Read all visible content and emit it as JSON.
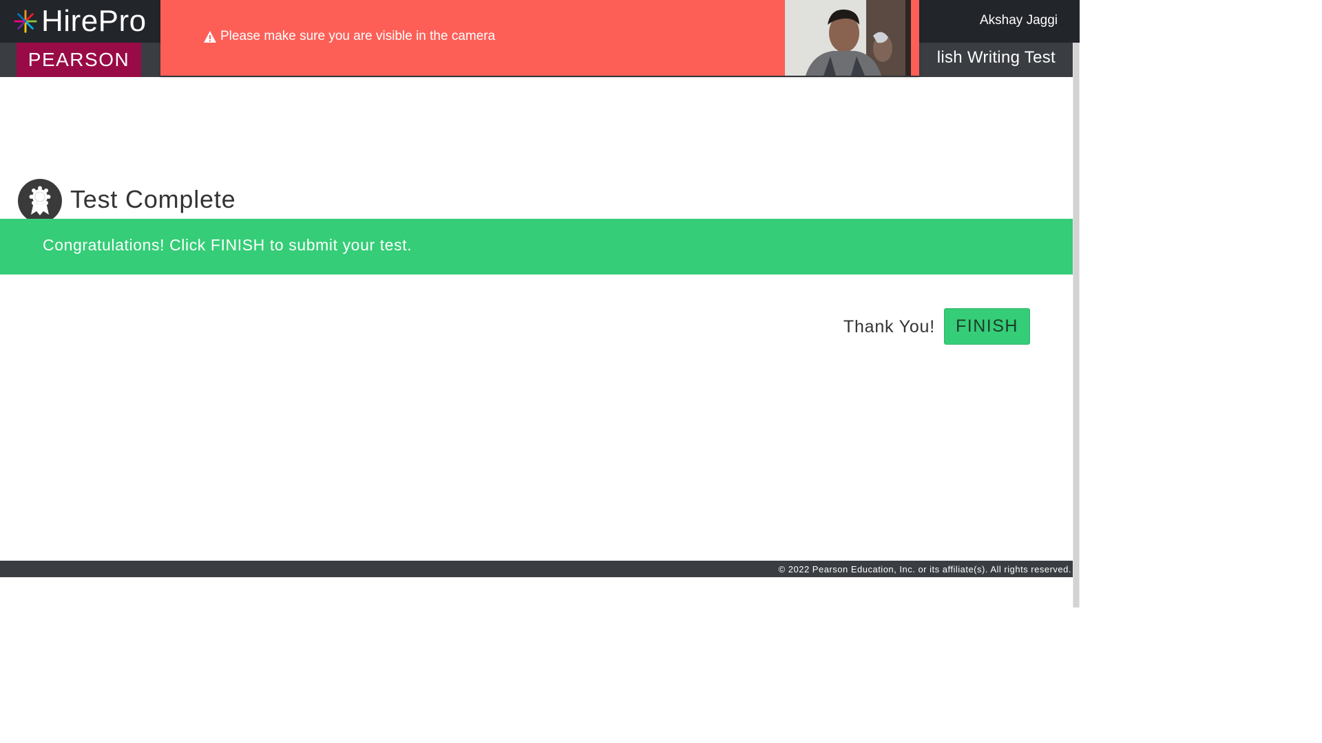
{
  "header": {
    "brand": "HirePro",
    "user_name": "Akshay Jaggi",
    "pearson_logo": "PEARSON",
    "test_title": "lish Writing Test"
  },
  "camera_warning": {
    "message": "Please make sure you are visible in the camera",
    "icon": "warning-icon"
  },
  "main": {
    "title": "Test Complete",
    "title_icon": "award-icon",
    "banner_text": "Congratulations! Click FINISH to submit your test.",
    "thank_you": "Thank You!",
    "finish_label": "FINISH"
  },
  "footer": {
    "copyright": "© 2022 Pearson Education, Inc. or its affiliate(s). All rights reserved."
  },
  "colors": {
    "topbar": "#22252a",
    "subbar": "#3a3d42",
    "pearson_brand": "#990b46",
    "warning_banner": "#fd5f57",
    "success": "#35cd77"
  }
}
